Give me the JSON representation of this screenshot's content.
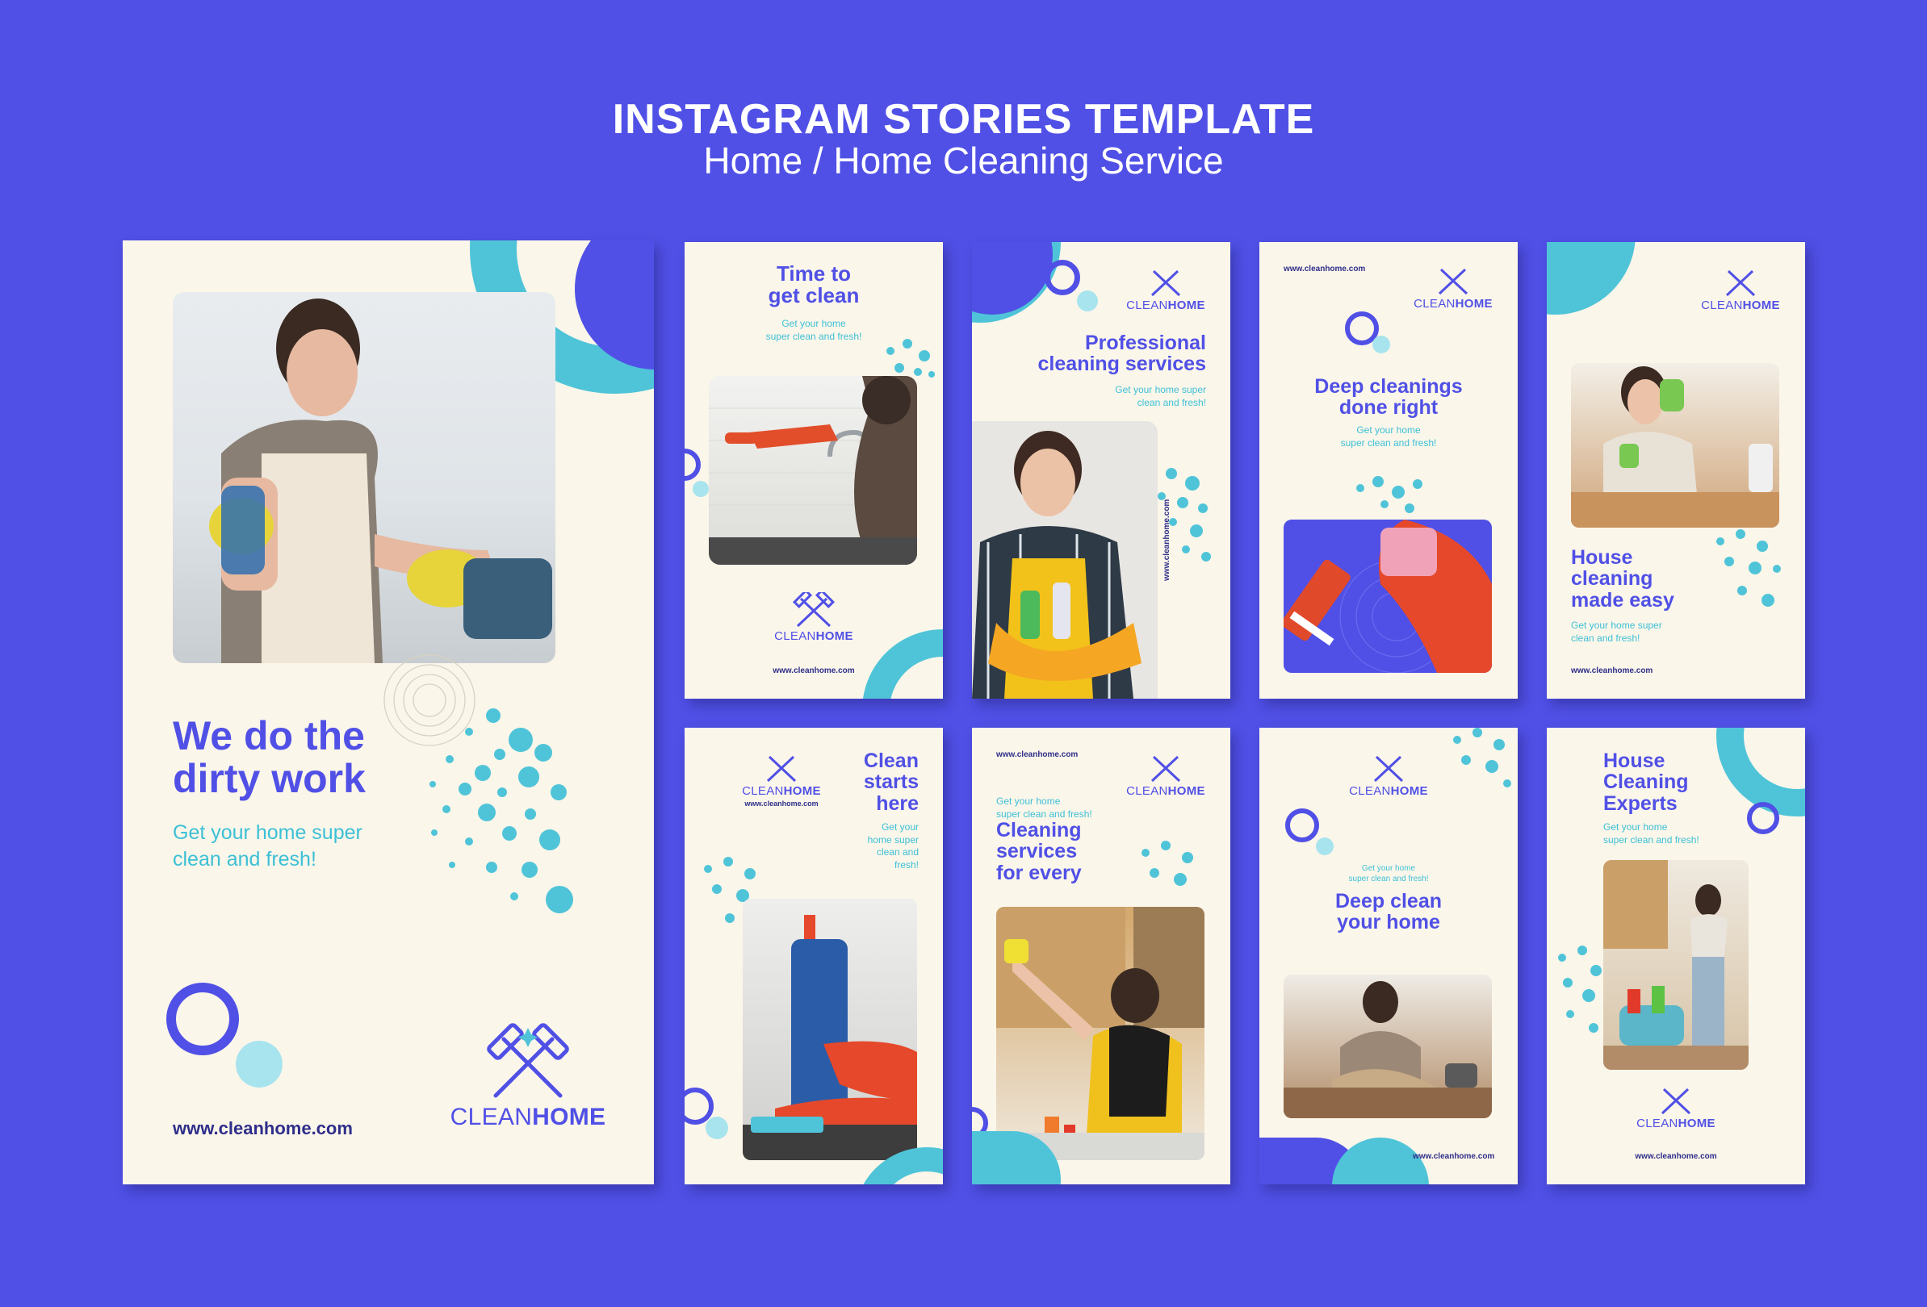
{
  "header": {
    "title": "INSTAGRAM STORIES TEMPLATE",
    "subtitle": "Home / Home Cleaning Service"
  },
  "brand": {
    "logo_light": "CLEAN",
    "logo_bold": "HOME",
    "website": "www.cleanhome.com"
  },
  "colors": {
    "background": "#5050e6",
    "card": "#fbf6ea",
    "accent": "#4fc4d8",
    "primary": "#5050e6"
  },
  "cards": {
    "main": {
      "headline": [
        "We do the",
        "dirty work"
      ],
      "subline": [
        "Get your home super",
        "clean and fresh!"
      ]
    },
    "c1": {
      "headline": [
        "Time to",
        "get clean"
      ],
      "subline": [
        "Get your home",
        "super clean and fresh!"
      ]
    },
    "c2": {
      "headline": [
        "Professional",
        "cleaning services"
      ],
      "subline": [
        "Get your home super",
        "clean and fresh!"
      ]
    },
    "c3": {
      "headline": [
        "Deep cleanings",
        "done right"
      ],
      "subline": [
        "Get your home",
        "super clean and fresh!"
      ]
    },
    "c4": {
      "headline": [
        "House",
        "cleaning",
        "made easy"
      ],
      "subline": [
        "Get your home super",
        "clean and fresh!"
      ]
    },
    "c5": {
      "headline": [
        "Clean",
        "starts",
        "here"
      ],
      "subline": [
        "Get your",
        "home super",
        "clean and",
        "fresh!"
      ]
    },
    "c6": {
      "headline": [
        "Cleaning",
        "services",
        "for every"
      ],
      "subline": [
        "Get your home",
        "super clean and fresh!"
      ]
    },
    "c7": {
      "headline": [
        "Deep clean",
        "your home"
      ],
      "subline": [
        "Get your home",
        "super clean and fresh!"
      ]
    },
    "c8": {
      "headline": [
        "House",
        "Cleaning",
        "Experts"
      ],
      "subline": [
        "Get your home",
        "super clean and fresh!"
      ]
    }
  },
  "icons": {
    "logo": "broom-squeegee-cross-icon"
  }
}
